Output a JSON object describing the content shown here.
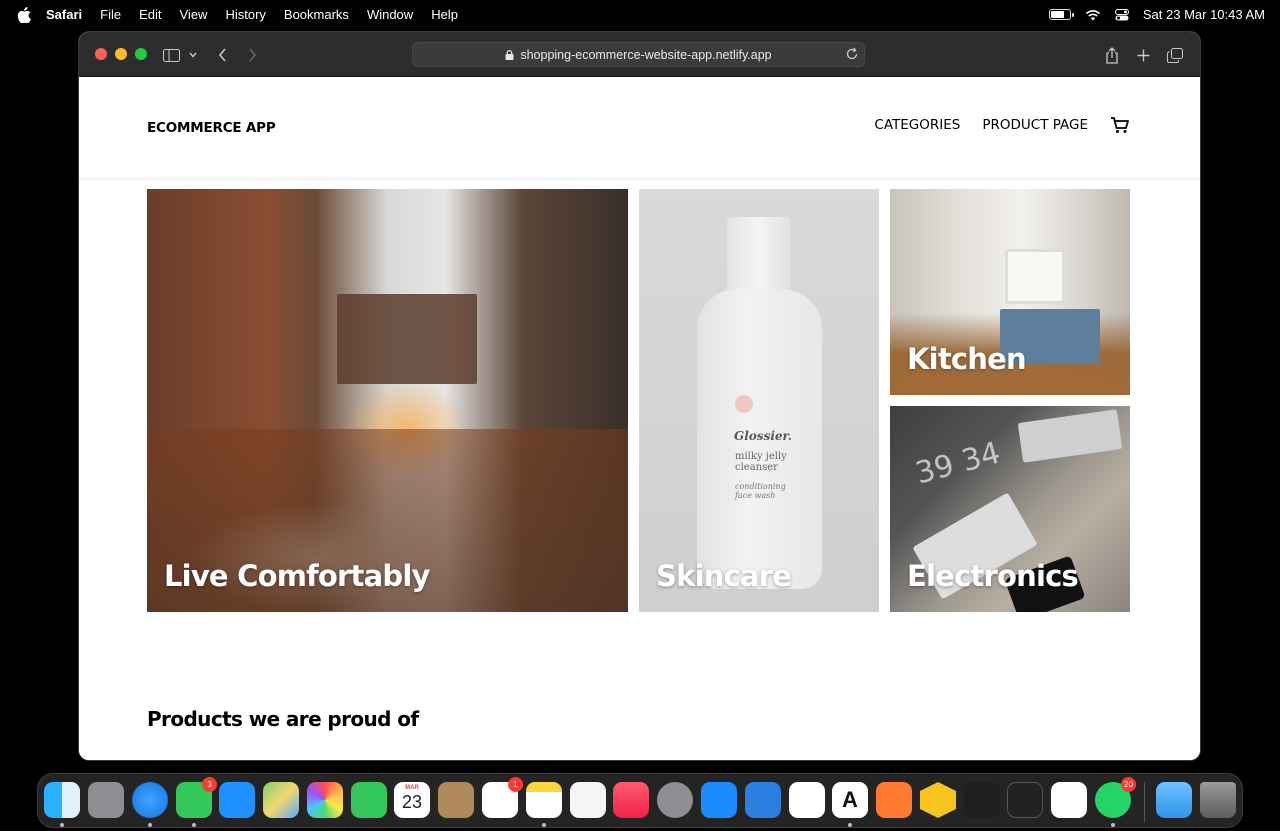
{
  "menubar": {
    "app_name": "Safari",
    "items": [
      "File",
      "Edit",
      "View",
      "History",
      "Bookmarks",
      "Window",
      "Help"
    ],
    "clock": "Sat 23 Mar  10:43 AM",
    "battery_level": 0.8
  },
  "browser": {
    "url": "shopping-ecommerce-website-app.netlify.app"
  },
  "site": {
    "logo": "ECOMMERCE APP",
    "nav": [
      "CATEGORIES",
      "PRODUCT PAGE"
    ],
    "tiles": [
      "Live Comfortably",
      "Skincare",
      "Kitchen",
      "Electronics"
    ],
    "skincare_product": {
      "brand": "Glossier.",
      "name_line1": "milky jelly",
      "name_line2": "cleanser",
      "desc_line1": "conditioning",
      "desc_line2": "face wash"
    },
    "electronics_numbers": "39 34",
    "section_title": "Products we are proud of"
  },
  "dock": {
    "apps": [
      {
        "name": "Finder",
        "badge": ""
      },
      {
        "name": "Launchpad",
        "badge": ""
      },
      {
        "name": "Safari",
        "badge": ""
      },
      {
        "name": "Messages",
        "badge": "3"
      },
      {
        "name": "Mail",
        "badge": ""
      },
      {
        "name": "Maps",
        "badge": ""
      },
      {
        "name": "Photos",
        "badge": ""
      },
      {
        "name": "FaceTime",
        "badge": ""
      },
      {
        "name": "Calendar",
        "badge": ""
      },
      {
        "name": "Contacts",
        "badge": ""
      },
      {
        "name": "Reminders",
        "badge": "1"
      },
      {
        "name": "Notes",
        "badge": ""
      },
      {
        "name": "Freeform",
        "badge": ""
      },
      {
        "name": "Music",
        "badge": ""
      },
      {
        "name": "System Settings",
        "badge": ""
      },
      {
        "name": "App Store",
        "badge": ""
      },
      {
        "name": "Xcode",
        "badge": ""
      },
      {
        "name": "Instruments",
        "badge": ""
      },
      {
        "name": "Anthropic",
        "badge": ""
      },
      {
        "name": "Pages",
        "badge": ""
      },
      {
        "name": "Bee",
        "badge": ""
      },
      {
        "name": "Shape",
        "badge": ""
      },
      {
        "name": "Zed",
        "badge": ""
      },
      {
        "name": "Slack",
        "badge": ""
      },
      {
        "name": "WhatsApp",
        "badge": "20"
      }
    ],
    "calendar": {
      "month": "MAR",
      "day": "23"
    },
    "anthropic_letter": "A"
  }
}
